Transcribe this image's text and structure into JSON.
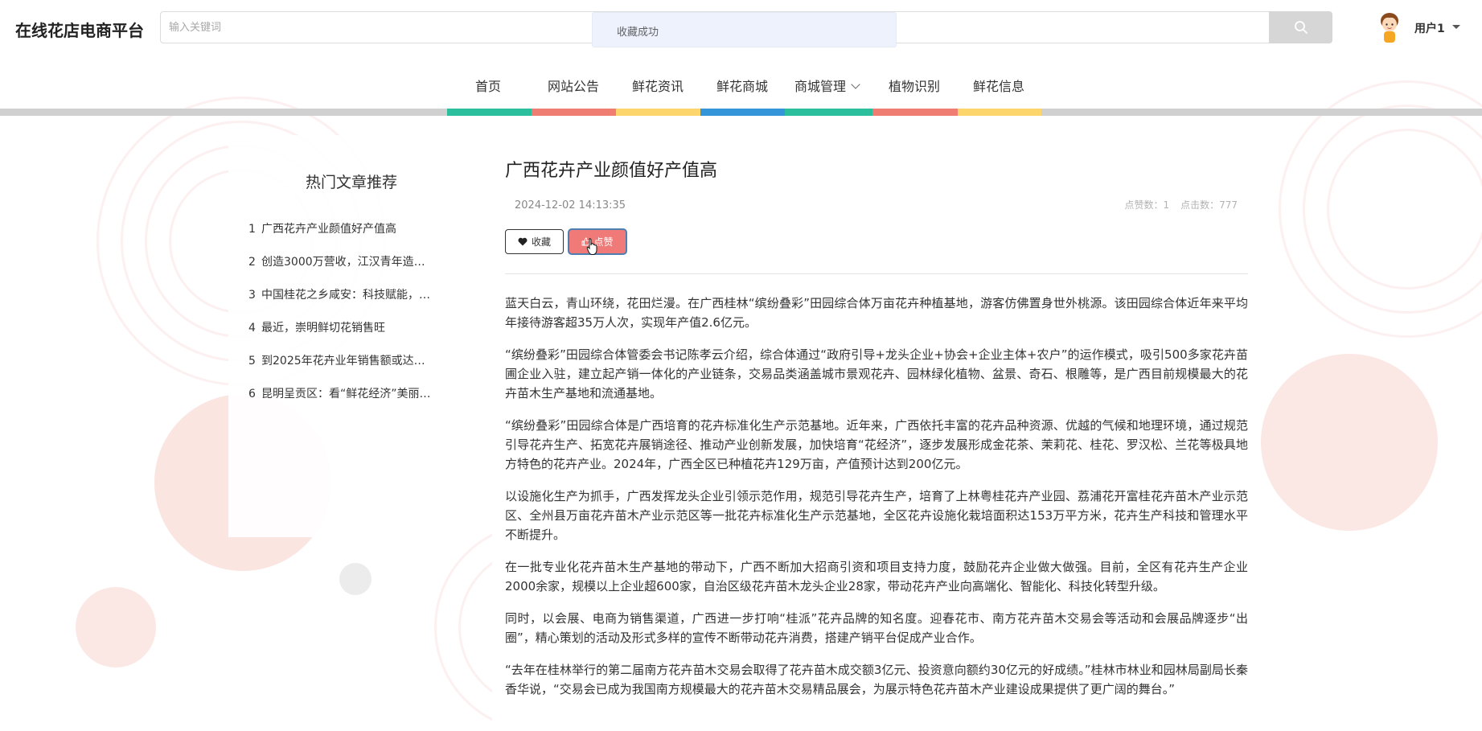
{
  "header": {
    "brand": "在线花店电商平台",
    "search_placeholder": "输入关键词",
    "user_name": "用户1"
  },
  "toast": {
    "message": "收藏成功"
  },
  "nav": {
    "items": [
      {
        "label": "首页"
      },
      {
        "label": "网站公告"
      },
      {
        "label": "鲜花资讯"
      },
      {
        "label": "鲜花商城"
      },
      {
        "label": "商城管理"
      },
      {
        "label": "植物识别"
      },
      {
        "label": "鲜花信息"
      }
    ],
    "colors": [
      "#2bbf9e",
      "#ef7d72",
      "#fcd56d",
      "#3496d8",
      "#2bbf9e",
      "#ef7d72",
      "#fcd56d"
    ]
  },
  "sidebar": {
    "title": "热门文章推荐",
    "items": [
      {
        "num": "1",
        "text": "广西花卉产业颜值好产值高"
      },
      {
        "num": "2",
        "text": "创造3000万营收，江汉青年造…"
      },
      {
        "num": "3",
        "text": "中国桂花之乡咸安：科技赋能，…"
      },
      {
        "num": "4",
        "text": "最近，崇明鲜切花销售旺"
      },
      {
        "num": "5",
        "text": "到2025年花卉业年销售额或达…"
      },
      {
        "num": "6",
        "text": "昆明呈贡区：看“鲜花经济”美丽…"
      }
    ]
  },
  "article": {
    "title": "广西花卉产业颜值好产值高",
    "date": "2024-12-02 14:13:35",
    "likes_label": "点赞数：1",
    "clicks_label": "点击数：777",
    "fav_label": "收藏",
    "like_label": "点赞",
    "paragraphs": [
      "蓝天白云，青山环绕，花田烂漫。在广西桂林“缤纷叠彩”田园综合体万亩花卉种植基地，游客仿佛置身世外桃源。该田园综合体近年来平均年接待游客超35万人次，实现年产值2.6亿元。",
      "“缤纷叠彩”田园综合体管委会书记陈孝云介绍，综合体通过“政府引导+龙头企业+协会+企业主体+农户”的运作模式，吸引500多家花卉苗圃企业入驻，建立起产销一体化的产业链条，交易品类涵盖城市景观花卉、园林绿化植物、盆景、奇石、根雕等，是广西目前规模最大的花卉苗木生产基地和流通基地。",
      "“缤纷叠彩”田园综合体是广西培育的花卉标准化生产示范基地。近年来，广西依托丰富的花卉品种资源、优越的气候和地理环境，通过规范引导花卉生产、拓宽花卉展销途径、推动产业创新发展，加快培育“花经济”，逐步发展形成金花茶、茉莉花、桂花、罗汉松、兰花等极具地方特色的花卉产业。2024年，广西全区已种植花卉129万亩，产值预计达到200亿元。",
      "以设施化生产为抓手，广西发挥龙头企业引领示范作用，规范引导花卉生产，培育了上林粤桂花卉产业园、荔浦花开富桂花卉苗木产业示范区、全州县万亩花卉苗木产业示范区等一批花卉标准化生产示范基地，全区花卉设施化栽培面积达153万平方米，花卉生产科技和管理水平不断提升。",
      "在一批专业化花卉苗木生产基地的带动下，广西不断加大招商引资和项目支持力度，鼓励花卉企业做大做强。目前，全区有花卉生产企业2000余家，规模以上企业超600家，自治区级花卉苗木龙头企业28家，带动花卉产业向高端化、智能化、科技化转型升级。",
      "同时，以会展、电商为销售渠道，广西进一步打响“桂派”花卉品牌的知名度。迎春花市、南方花卉苗木交易会等活动和会展品牌逐步“出圈”，精心策划的活动及形式多样的宣传不断带动花卉消费，搭建产销平台促成产业合作。",
      "“去年在桂林举行的第二届南方花卉苗木交易会取得了花卉苗木成交额3亿元、投资意向额约30亿元的好成绩。”桂林市林业和园林局副局长秦香华说，“交易会已成为我国南方规模最大的花卉苗木交易精品展会，为展示特色花卉苗木产业建设成果提供了更广阔的舞台。”"
    ]
  }
}
